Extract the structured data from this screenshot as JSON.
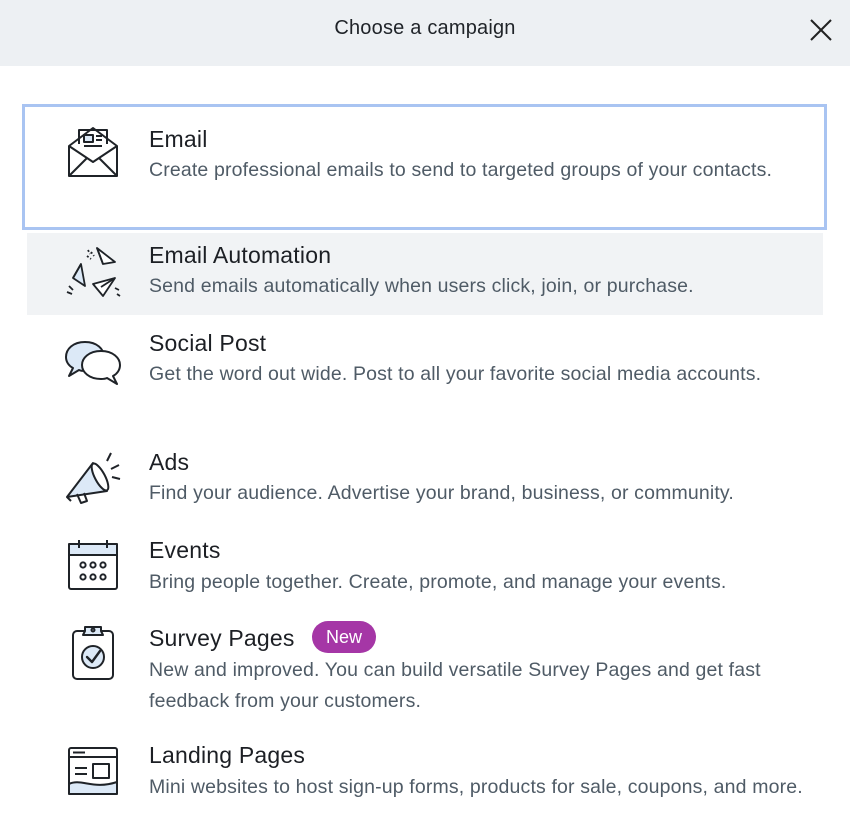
{
  "header": {
    "title": "Choose a campaign",
    "close_icon": "close-icon"
  },
  "options": [
    {
      "title": "Email",
      "description": "Create professional emails to send to targeted groups of your contacts.",
      "icon": "envelope-newsletter-icon",
      "selected": true
    },
    {
      "title": "Email Automation",
      "description": "Send emails automatically when users click, join, or purchase.",
      "icon": "paper-planes-icon",
      "hovered": true
    },
    {
      "title": "Social Post",
      "description": "Get the word out wide. Post to all your favorite social media accounts.",
      "icon": "speech-bubbles-icon"
    },
    {
      "title": "Ads",
      "description": "Find your audience. Advertise your brand, business, or community.",
      "icon": "megaphone-icon"
    },
    {
      "title": "Events",
      "description": "Bring people together. Create, promote, and manage your events.",
      "icon": "calendar-icon"
    },
    {
      "title": "Survey Pages",
      "badge": "New",
      "description": "New and improved. You can build versatile Survey Pages and get fast feedback from your customers.",
      "icon": "clipboard-check-icon"
    },
    {
      "title": "Landing Pages",
      "description": "Mini websites to host sign-up forms, products for sale, coupons, and more.",
      "icon": "webpage-icon"
    }
  ],
  "colors": {
    "header_bg": "#edf0f3",
    "selected_border": "#a9c4f2",
    "hover_bg": "#f1f3f5",
    "badge_bg": "#a536a6",
    "title_text": "#1c1f24",
    "desc_text": "#4f5b66",
    "icon_fill": "#dce9f7"
  }
}
